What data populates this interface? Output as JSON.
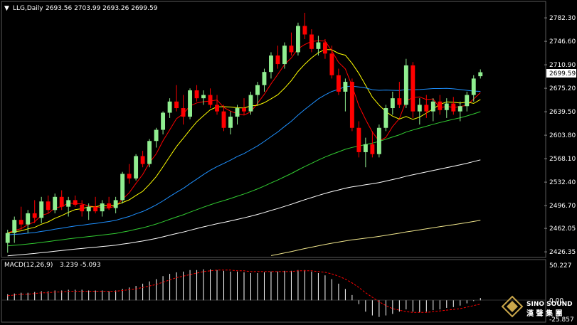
{
  "header": {
    "symbol_label": "LLG,Daily",
    "ohlc_text": "2693.56 2703.99 2693.26 2699.59"
  },
  "macd_header": {
    "label": "MACD(12,26,9)",
    "values_text": "3.239 -5.093"
  },
  "logo": {
    "line1": "SINO SOUND",
    "line2": "漢 聲 集 團"
  },
  "colors": {
    "background": "#000000",
    "bull_candle": "#90ee90",
    "bear_candle": "#ff0000",
    "ma_fast": "#ff0000",
    "ma_mid": "#ffff00",
    "ma_slow_blue": "#1e90ff",
    "ma_green": "#32cd32",
    "ma_white": "#ffffff",
    "ma_longest": "#f0e68c",
    "macd_hist": "#ffffff",
    "macd_signal": "#ff0000",
    "axis_text": "#ffffff"
  },
  "chart_data": [
    {
      "type": "candlestick",
      "title": "LLG,Daily",
      "y_ticks": [
        "2782.30",
        "2746.60",
        "2710.90",
        "2675.20",
        "2639.50",
        "2603.80",
        "2568.10",
        "2532.40",
        "2496.70",
        "2462.05",
        "2426.35"
      ],
      "current_price_label": "2699.59",
      "ylim": [
        2420,
        2790
      ],
      "candles": [
        [
          2440,
          2460,
          2425,
          2455
        ],
        [
          2455,
          2480,
          2440,
          2475
        ],
        [
          2475,
          2495,
          2460,
          2468
        ],
        [
          2468,
          2490,
          2455,
          2485
        ],
        [
          2485,
          2505,
          2470,
          2478
        ],
        [
          2478,
          2510,
          2470,
          2503
        ],
        [
          2503,
          2512,
          2485,
          2490
        ],
        [
          2490,
          2515,
          2485,
          2510
        ],
        [
          2510,
          2520,
          2490,
          2495
        ],
        [
          2495,
          2510,
          2480,
          2505
        ],
        [
          2505,
          2512,
          2495,
          2498
        ],
        [
          2498,
          2505,
          2480,
          2488
        ],
        [
          2488,
          2500,
          2475,
          2495
        ],
        [
          2495,
          2510,
          2485,
          2488
        ],
        [
          2488,
          2505,
          2480,
          2500
        ],
        [
          2500,
          2510,
          2490,
          2493
        ],
        [
          2493,
          2510,
          2485,
          2505
        ],
        [
          2505,
          2548,
          2500,
          2545
        ],
        [
          2545,
          2560,
          2530,
          2538
        ],
        [
          2538,
          2575,
          2535,
          2572
        ],
        [
          2572,
          2580,
          2555,
          2560
        ],
        [
          2560,
          2598,
          2555,
          2595
        ],
        [
          2595,
          2615,
          2585,
          2612
        ],
        [
          2612,
          2640,
          2605,
          2638
        ],
        [
          2638,
          2660,
          2630,
          2655
        ],
        [
          2655,
          2680,
          2640,
          2645
        ],
        [
          2645,
          2665,
          2620,
          2632
        ],
        [
          2632,
          2675,
          2628,
          2672
        ],
        [
          2672,
          2680,
          2655,
          2660
        ],
        [
          2660,
          2672,
          2650,
          2665
        ],
        [
          2665,
          2675,
          2645,
          2650
        ],
        [
          2650,
          2665,
          2635,
          2640
        ],
        [
          2640,
          2650,
          2610,
          2615
        ],
        [
          2615,
          2640,
          2605,
          2632
        ],
        [
          2632,
          2650,
          2620,
          2645
        ],
        [
          2645,
          2660,
          2635,
          2640
        ],
        [
          2640,
          2670,
          2635,
          2665
        ],
        [
          2665,
          2685,
          2650,
          2680
        ],
        [
          2680,
          2705,
          2670,
          2700
        ],
        [
          2700,
          2730,
          2690,
          2725
        ],
        [
          2725,
          2740,
          2705,
          2712
        ],
        [
          2712,
          2745,
          2705,
          2740
        ],
        [
          2740,
          2760,
          2725,
          2730
        ],
        [
          2730,
          2775,
          2725,
          2770
        ],
        [
          2770,
          2790,
          2750,
          2757
        ],
        [
          2757,
          2765,
          2730,
          2735
        ],
        [
          2735,
          2755,
          2725,
          2745
        ],
        [
          2745,
          2750,
          2720,
          2728
        ],
        [
          2728,
          2740,
          2690,
          2695
        ],
        [
          2695,
          2705,
          2665,
          2670
        ],
        [
          2670,
          2690,
          2640,
          2685
        ],
        [
          2685,
          2690,
          2610,
          2615
        ],
        [
          2615,
          2625,
          2570,
          2578
        ],
        [
          2578,
          2600,
          2555,
          2590
        ],
        [
          2590,
          2610,
          2570,
          2575
        ],
        [
          2575,
          2620,
          2570,
          2615
        ],
        [
          2615,
          2650,
          2610,
          2645
        ],
        [
          2645,
          2670,
          2635,
          2660
        ],
        [
          2660,
          2685,
          2645,
          2650
        ],
        [
          2650,
          2720,
          2645,
          2710
        ],
        [
          2710,
          2715,
          2630,
          2640
        ],
        [
          2640,
          2660,
          2620,
          2650
        ],
        [
          2650,
          2665,
          2630,
          2640
        ],
        [
          2640,
          2660,
          2625,
          2655
        ],
        [
          2655,
          2665,
          2635,
          2642
        ],
        [
          2642,
          2660,
          2630,
          2652
        ],
        [
          2652,
          2662,
          2635,
          2640
        ],
        [
          2640,
          2655,
          2625,
          2648
        ],
        [
          2648,
          2670,
          2640,
          2665
        ],
        [
          2665,
          2695,
          2655,
          2690
        ],
        [
          2693.56,
          2703.99,
          2690,
          2699.59
        ]
      ],
      "moving_averages": [
        {
          "period": 5,
          "color": "#ff0000"
        },
        {
          "period": 10,
          "color": "#ffff00"
        },
        {
          "period": 30,
          "color": "#1e90ff"
        },
        {
          "period": 60,
          "color": "#32cd32"
        },
        {
          "period": 100,
          "color": "#ffffff"
        },
        {
          "period": 200,
          "color": "#f0e68c"
        }
      ]
    },
    {
      "type": "macd",
      "title": "MACD(12,26,9)",
      "y_ticks": [
        "50.227",
        "0.00",
        "-25.857"
      ],
      "ylim": [
        -27,
        52
      ],
      "histogram": [
        8,
        9,
        10,
        10,
        11,
        12,
        12,
        13,
        13,
        14,
        14,
        14,
        13,
        13,
        13,
        12,
        13,
        15,
        17,
        19,
        22,
        25,
        28,
        32,
        35,
        37,
        38,
        40,
        40,
        41,
        41,
        40,
        39,
        38,
        38,
        37,
        36,
        36,
        37,
        38,
        38,
        39,
        39,
        40,
        40,
        38,
        36,
        33,
        28,
        22,
        15,
        7,
        -5,
        -15,
        -20,
        -22,
        -20,
        -18,
        -15,
        -12,
        -15,
        -16,
        -15,
        -13,
        -12,
        -10,
        -9,
        -7,
        -4,
        -1,
        3
      ],
      "signal": [
        6,
        7,
        8,
        8,
        9,
        10,
        10,
        11,
        11,
        12,
        12,
        12,
        12,
        12,
        12,
        12,
        12,
        13,
        14,
        15,
        17,
        19,
        21,
        24,
        27,
        30,
        32,
        34,
        36,
        38,
        39,
        40,
        40,
        40,
        39,
        39,
        38,
        38,
        38,
        38,
        38,
        38,
        38,
        39,
        39,
        39,
        38,
        37,
        35,
        32,
        28,
        23,
        17,
        10,
        4,
        -2,
        -7,
        -11,
        -13,
        -15,
        -16,
        -16,
        -16,
        -15,
        -14,
        -13,
        -12,
        -11,
        -9,
        -7,
        -5
      ]
    }
  ]
}
